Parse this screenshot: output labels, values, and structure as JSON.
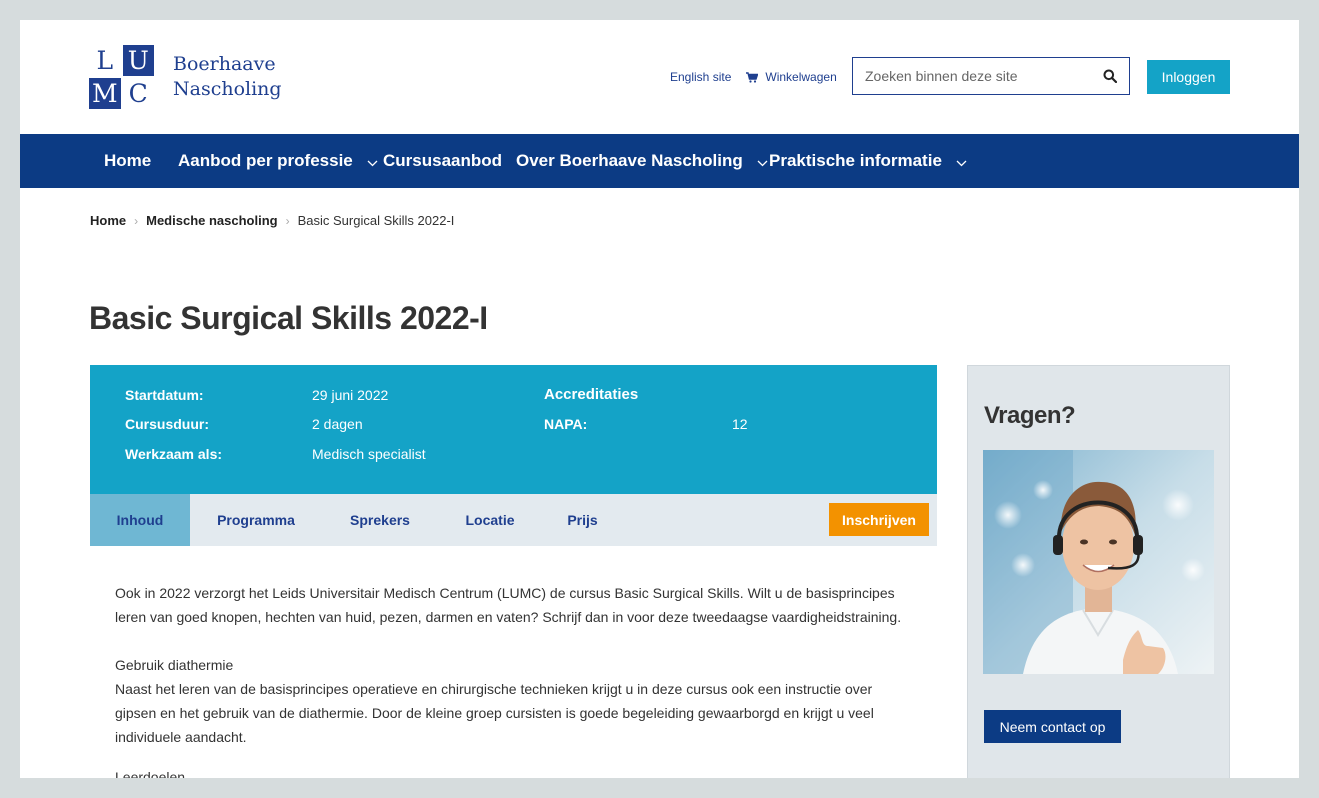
{
  "header": {
    "logo_letters": [
      "L",
      "U",
      "M",
      "C"
    ],
    "logo_line1": "Boerhaave",
    "logo_line2": "Nascholing",
    "english_site": "English site",
    "cart": "Winkelwagen",
    "search_placeholder": "Zoeken binnen deze site",
    "login": "Inloggen"
  },
  "nav": [
    {
      "label": "Home",
      "dropdown": false
    },
    {
      "label": "Aanbod per professie",
      "dropdown": true
    },
    {
      "label": "Cursusaanbod",
      "dropdown": false
    },
    {
      "label": "Over Boerhaave Nascholing",
      "dropdown": true
    },
    {
      "label": "Praktische informatie",
      "dropdown": true
    }
  ],
  "breadcrumb": [
    "Home",
    "Medische nascholing",
    "Basic Surgical Skills 2022-I"
  ],
  "title": "Basic Surgical Skills 2022-I",
  "info": {
    "start_label": "Startdatum:",
    "start_value": "29 juni 2022",
    "duration_label": "Cursusduur:",
    "duration_value": "2 dagen",
    "role_label": "Werkzaam als:",
    "role_value": "Medisch specialist",
    "accreditations_title": "Accreditaties",
    "napa_label": "NAPA:",
    "napa_value": "12"
  },
  "tabs": [
    "Inhoud",
    "Programma",
    "Sprekers",
    "Locatie",
    "Prijs"
  ],
  "active_tab": "Inhoud",
  "enroll": "Inschrijven",
  "content": {
    "intro_1": "Ook in 2022 verzorgt het Leids Universitair Medisch Centrum (LUMC) de cursus Basic Surgical Skills. Wilt u de basisprincipes",
    "intro_2": "leren van goed knopen, hechten van huid, pezen, darmen en vaten? Schrijf dan in voor deze tweedaagse vaardigheidstraining.",
    "heading_1": "Gebruik diathermie",
    "para_1": "Naast het leren van de basisprincipes operatieve en chirurgische technieken krijgt u in deze cursus ook een instructie over",
    "para_2": "gipsen en het gebruik van de diathermie. Door de kleine groep cursisten is goede begeleiding gewaarborgd en krijgt u veel",
    "para_3": "individuele aandacht.",
    "heading_2": "Leerdoelen"
  },
  "sidebar": {
    "title": "Vragen?",
    "contact": "Neem contact op"
  },
  "colors": {
    "primary": "#0c3b84",
    "accent": "#14a3c7",
    "orange": "#f39200"
  }
}
